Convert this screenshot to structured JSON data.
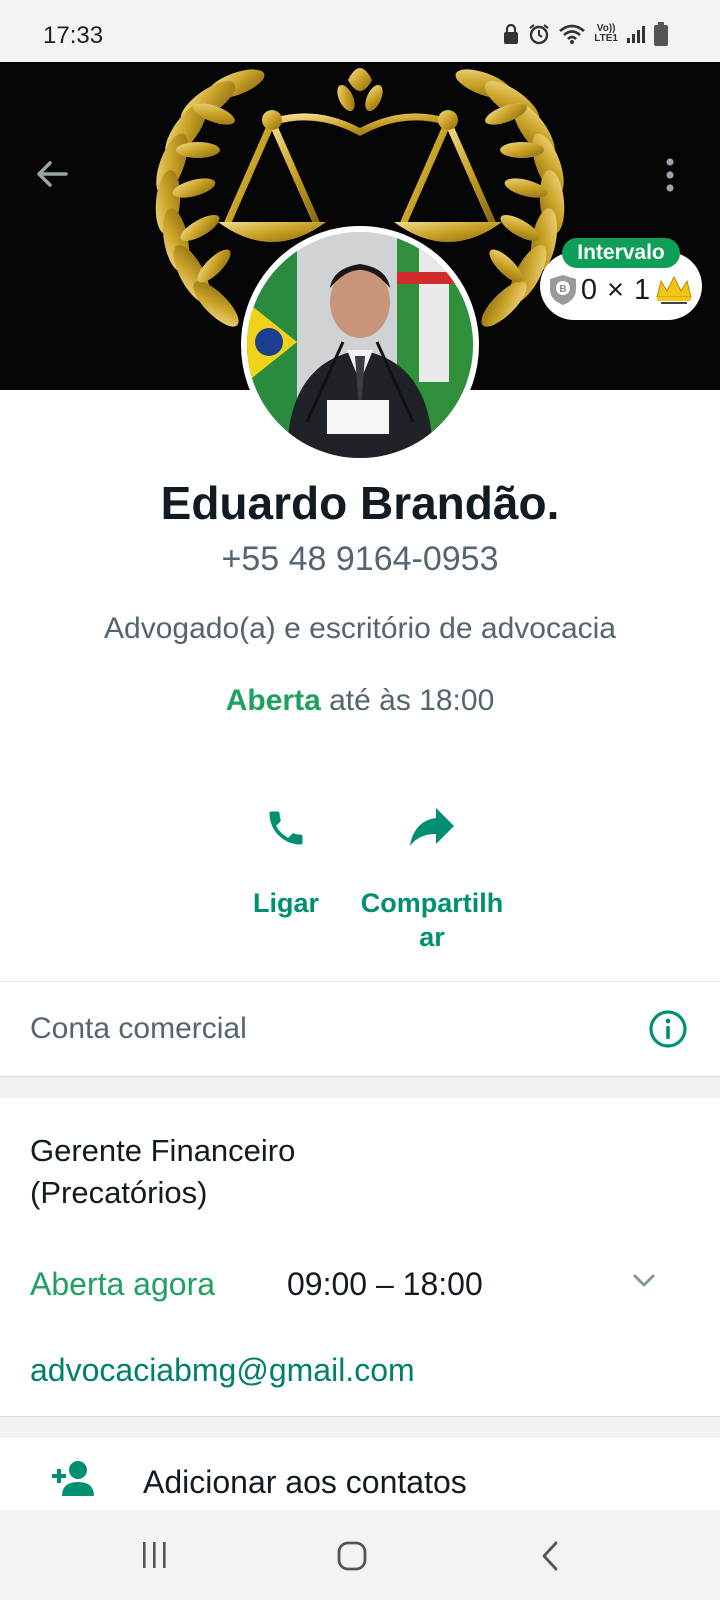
{
  "status_bar": {
    "time": "17:33",
    "network_label_top": "Vo))",
    "network_label_bottom": "LTE1",
    "icons": [
      "lock-icon",
      "alarm-icon",
      "wifi-icon",
      "signal-icon",
      "battery-icon"
    ]
  },
  "header": {
    "back_icon": "arrow-back-icon",
    "menu_icon": "more-vert-icon"
  },
  "score_widget": {
    "status": "Intervalo",
    "score": "0 × 1"
  },
  "profile": {
    "name": "Eduardo Brandão.",
    "phone": "+55 48 9164-0953",
    "category": "Advogado(a) e escritório de advocacia",
    "open_status": "Aberta",
    "open_until": " até às 18:00"
  },
  "actions": [
    {
      "label": "Ligar",
      "icon": "phone-icon"
    },
    {
      "label": "Compartilhar",
      "icon": "share-icon"
    }
  ],
  "business": {
    "label": "Conta comercial",
    "icon": "info-icon"
  },
  "details": {
    "description": "Gerente Financeiro (Precatórios)",
    "hours_status": "Aberta agora",
    "hours_range": "09:00 – 18:00",
    "email": "advocaciabmg@gmail.com"
  },
  "contact_action": {
    "label": "Adicionar aos contatos",
    "icon": "person-add-icon"
  },
  "colors": {
    "accent_green": "#1ea05f",
    "teal": "#008069",
    "secondary_text": "#54656f",
    "gold": "#c9a227"
  }
}
